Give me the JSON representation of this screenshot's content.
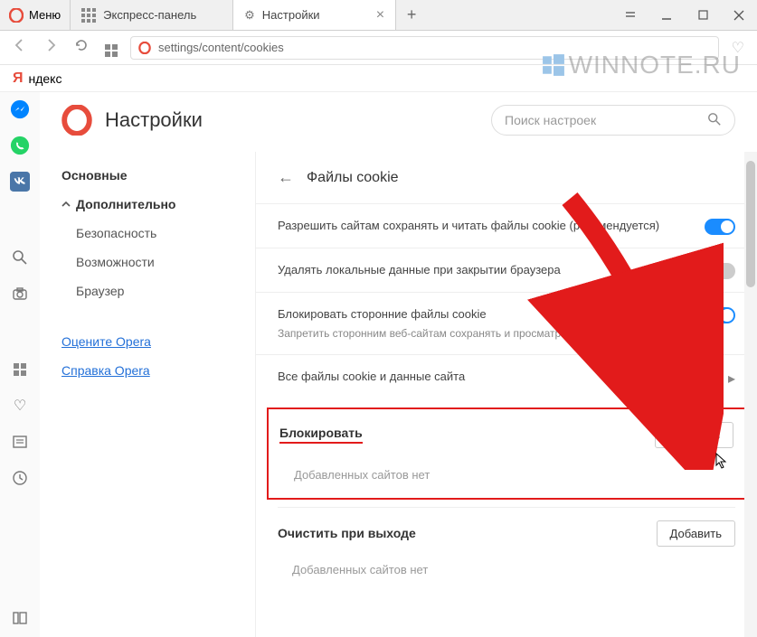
{
  "window": {
    "menu_label": "Меню",
    "tabs": [
      {
        "label": "Экспресс-панель",
        "icon": "speed-dial"
      },
      {
        "label": "Настройки",
        "icon": "gear"
      }
    ]
  },
  "address": {
    "url": "settings/content/cookies"
  },
  "yandex": {
    "letter": "Я",
    "text": "ндекс"
  },
  "watermark": "WINNOTE.RU",
  "settings": {
    "page_title": "Настройки",
    "search_placeholder": "Поиск настроек",
    "nav": {
      "basic": "Основные",
      "advanced": "Дополнительно",
      "security": "Безопасность",
      "features": "Возможности",
      "browser": "Браузер",
      "rate": "Оцените Opera",
      "help": "Справка Opera"
    },
    "cookies": {
      "heading": "Файлы cookie",
      "row_allow": "Разрешить сайтам сохранять и читать файлы cookie (рекомендуется)",
      "row_delete": "Удалять локальные данные при закрытии браузера",
      "row_block_third": "Блокировать сторонние файлы cookie",
      "row_block_third_sub": "Запретить сторонним веб-сайтам сохранять и просматривать файлы cookie",
      "row_all": "Все файлы cookie и данные сайта",
      "block": {
        "title": "Блокировать",
        "add": "Добавить",
        "empty": "Добавленных сайтов нет"
      },
      "clear": {
        "title": "Очистить при выходе",
        "add": "Добавить",
        "empty": "Добавленных сайтов нет"
      }
    }
  }
}
